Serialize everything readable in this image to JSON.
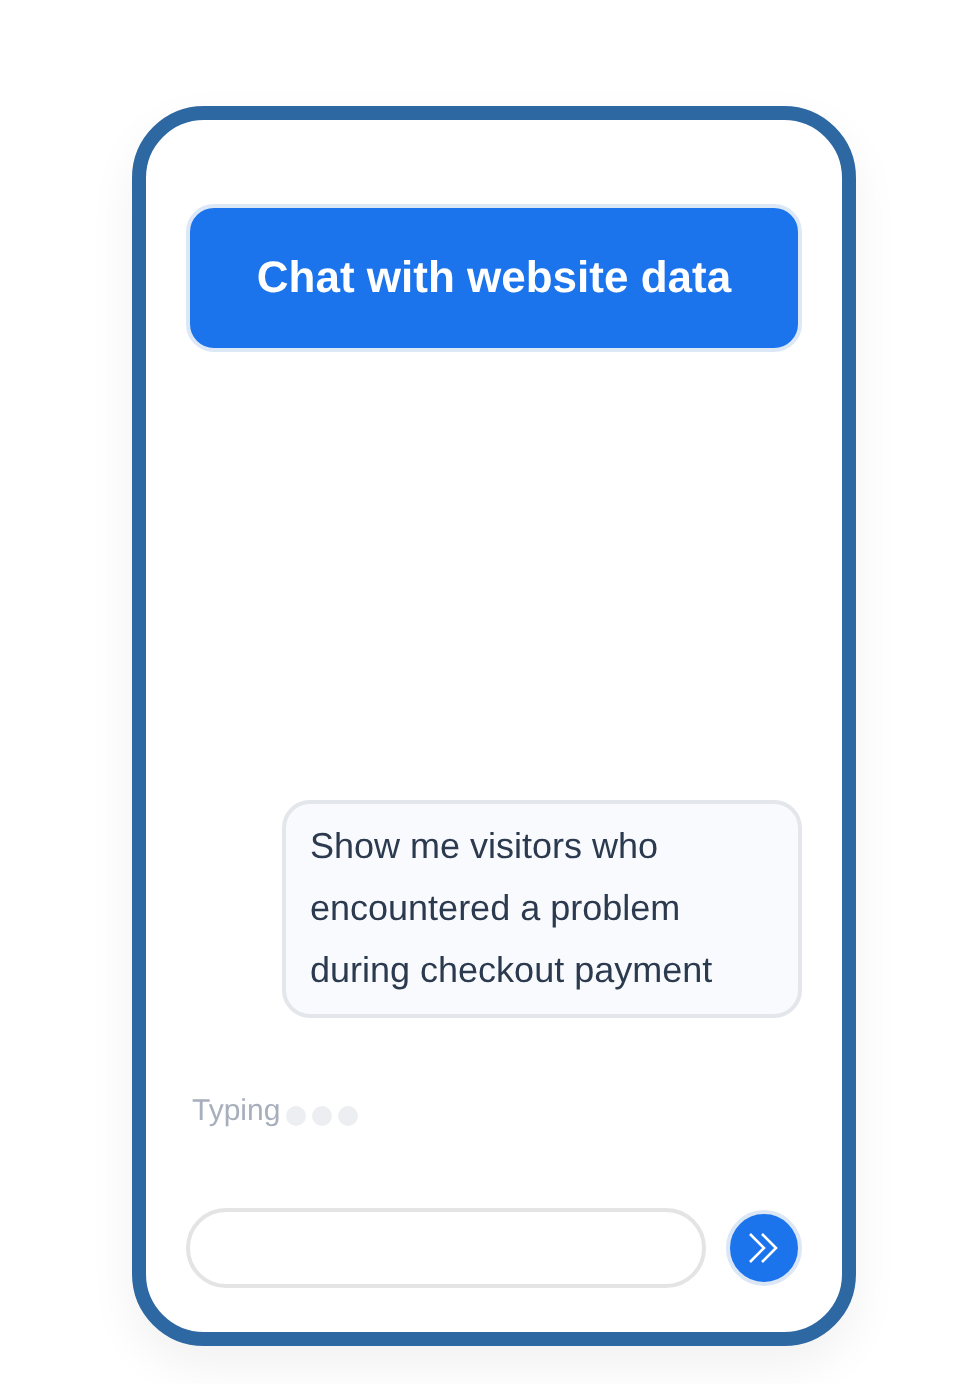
{
  "header": {
    "title": "Chat with website data"
  },
  "messages": [
    {
      "text": "Show me visitors who encountered a problem during checkout payment"
    }
  ],
  "typing": {
    "label": "Typing"
  }
}
